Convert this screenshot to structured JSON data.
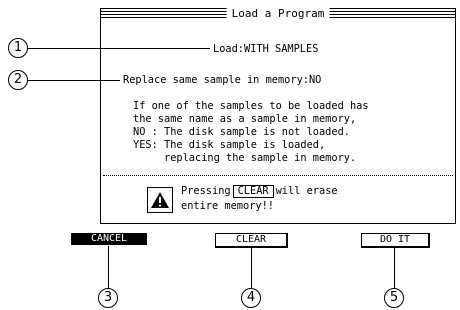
{
  "screen": {
    "title": "Load a Program",
    "load_line": "Load:WITH SAMPLES",
    "replace_line": "Replace same sample in memory:NO",
    "info_lines": [
      "If one of the samples to be loaded has",
      "the same name as a sample in memory,",
      "NO : The disk sample is not loaded.",
      "YES: The disk sample is loaded,",
      "     replacing the sample in memory."
    ],
    "warning": {
      "icon": "warning-icon",
      "prefix": "Pressing",
      "button": "CLEAR",
      "suffix": "will erase",
      "line2": "entire memory!!"
    }
  },
  "softkeys": [
    "CANCEL",
    "CLEAR",
    "DO IT"
  ],
  "callouts": [
    "1",
    "2",
    "3",
    "4",
    "5"
  ]
}
